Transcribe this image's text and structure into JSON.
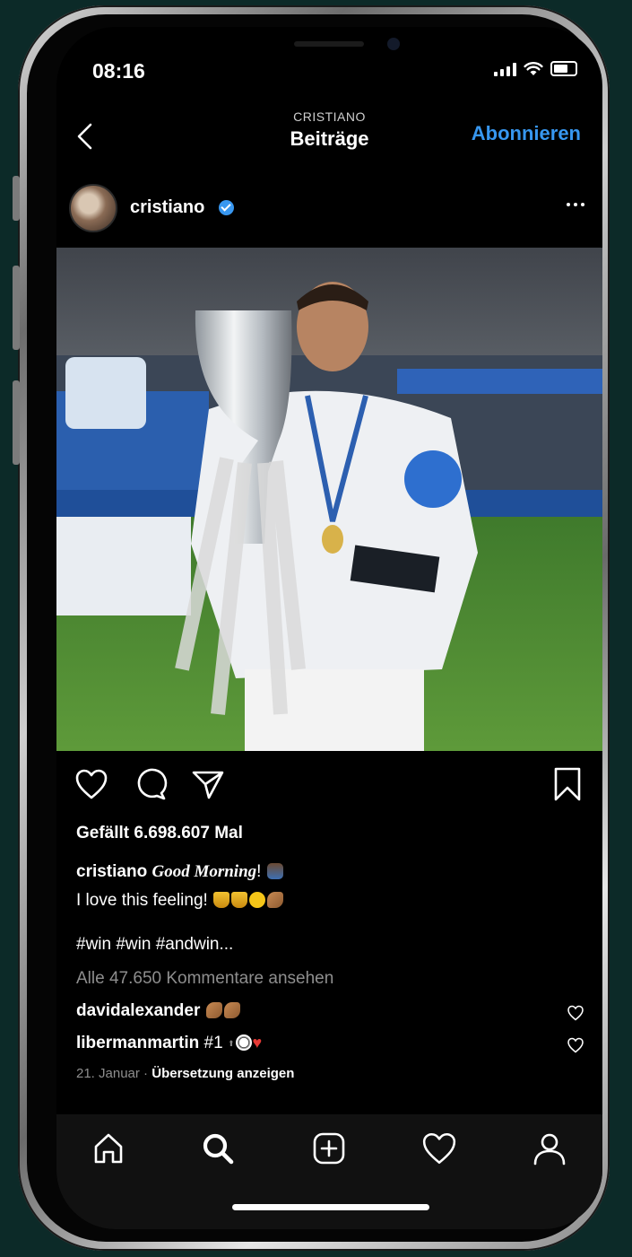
{
  "status_bar": {
    "time": "08:16"
  },
  "header": {
    "kicker": "CRISTIANO",
    "title": "Beiträge",
    "follow_label": "Abonnieren"
  },
  "post": {
    "username": "cristiano",
    "verified": true,
    "likes_text": "Gefällt 6.698.607 Mal",
    "caption": {
      "user": "cristiano",
      "script_text": "Good Morning",
      "after_script": "!",
      "line2": "I love this feeling!"
    },
    "hashtags": "#win #win #andwin...",
    "view_all_comments": "Alle 47.650 Kommentare ansehen",
    "comments": [
      {
        "user": "davidalexander",
        "text": ""
      },
      {
        "user": "libermanmartin",
        "text": "#1"
      }
    ],
    "date": "21. Januar",
    "separator": " · ",
    "translate_label": "Übersetzung anzeigen"
  },
  "icons": {
    "status": [
      "signal-icon",
      "wifi-icon",
      "battery-icon"
    ],
    "actions": [
      "heart-icon",
      "comment-icon",
      "share-icon",
      "bookmark-icon"
    ],
    "tabs": [
      "home-icon",
      "search-icon",
      "add-post-icon",
      "activity-heart-icon",
      "profile-icon"
    ]
  },
  "colors": {
    "accent": "#3797f0",
    "background": "#000000",
    "secondary_text": "#8e8e8e"
  }
}
